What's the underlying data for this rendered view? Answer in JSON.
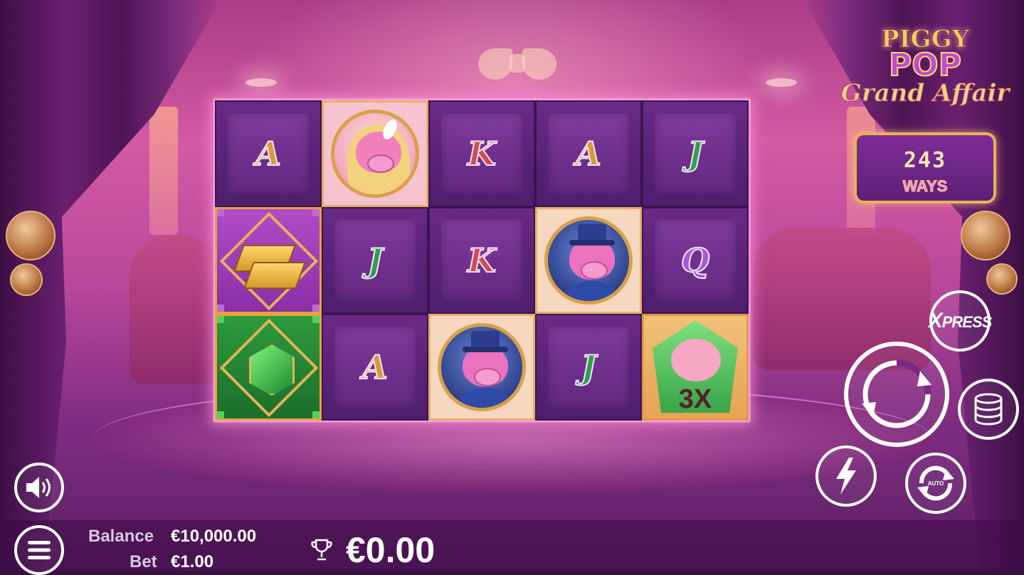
{
  "game": {
    "logo": {
      "line1": "PIGGY",
      "line2": "POP",
      "line3": "Grand Affair"
    },
    "ways": {
      "count": "243",
      "label": "WAYS"
    }
  },
  "reels": {
    "columns": 5,
    "rows": 3,
    "symbols": [
      [
        "A",
        "lady-pig",
        "K",
        "A",
        "J"
      ],
      [
        "gold-bars",
        "J",
        "K",
        "gent-pig",
        "Q"
      ],
      [
        "emerald",
        "A",
        "gent-pig",
        "J",
        "wild-pig-3x"
      ]
    ],
    "wild_multiplier": "3X"
  },
  "controls": {
    "xpress_label": "XPRESS",
    "icons": {
      "spin": "spin-arrow-icon",
      "bet": "coin-stack-icon",
      "turbo": "lightning-icon",
      "autoplay": "autoplay-icon",
      "sound": "speaker-icon",
      "menu": "hamburger-menu-icon",
      "win": "trophy-icon"
    }
  },
  "status_bar": {
    "balance_label": "Balance",
    "balance_value": "€10,000.00",
    "bet_label": "Bet",
    "bet_value": "€1.00",
    "win_value": "€0.00"
  },
  "colors": {
    "frame_glow": "#ff8cdc",
    "gold": "#e6a43a",
    "letter_a": "#d99a33",
    "letter_k": "#d44a4a",
    "letter_j": "#2ea14a",
    "letter_q": "#a55bd6"
  }
}
